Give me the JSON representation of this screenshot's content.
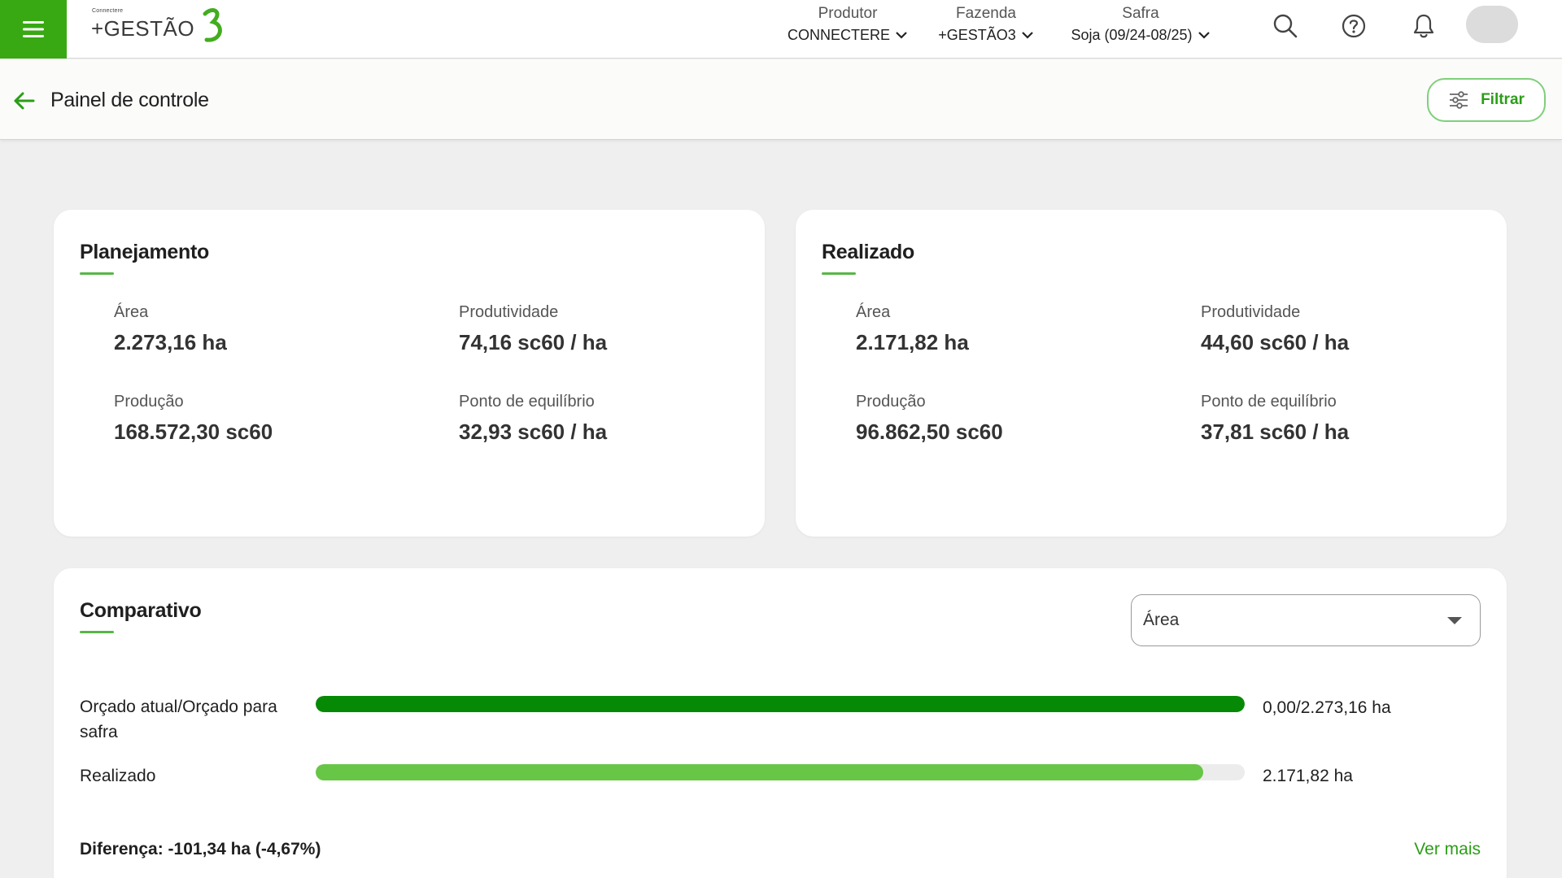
{
  "colors": {
    "brand_green": "#38a813",
    "accent_green": "#2c9d18",
    "bar_planned": "#068a05",
    "bar_realized": "#67c645",
    "background": "#efefef"
  },
  "header": {
    "logo_small": "Connectere",
    "logo_text": "+GESTÃO",
    "selectors": [
      {
        "label": "Produtor",
        "value": "CONNECTERE"
      },
      {
        "label": "Fazenda",
        "value": "+GESTÃO3"
      },
      {
        "label": "Safra",
        "value": "Soja (09/24-08/25)"
      }
    ],
    "icons": [
      "menu-icon",
      "search-icon",
      "help-icon",
      "bell-icon",
      "avatar"
    ]
  },
  "subheader": {
    "title": "Painel de controle",
    "filter_label": "Filtrar"
  },
  "planejamento": {
    "title": "Planejamento",
    "metrics": [
      {
        "label": "Área",
        "value": "2.273,16 ha"
      },
      {
        "label": "Produtividade",
        "value": "74,16 sc60 / ha"
      },
      {
        "label": "Produção",
        "value": "168.572,30 sc60"
      },
      {
        "label": "Ponto de equilíbrio",
        "value": "32,93 sc60 / ha"
      }
    ]
  },
  "realizado": {
    "title": "Realizado",
    "metrics": [
      {
        "label": "Área",
        "value": "2.171,82 ha"
      },
      {
        "label": "Produtividade",
        "value": "44,60 sc60 / ha"
      },
      {
        "label": "Produção",
        "value": "96.862,50 sc60"
      },
      {
        "label": "Ponto de equilíbrio",
        "value": "37,81 sc60 / ha"
      }
    ]
  },
  "comparativo": {
    "title": "Comparativo",
    "select_value": "Área",
    "rows": [
      {
        "label": "Orçado atual/Orçado para safra",
        "value_text": "0,00/2.273,16 ha",
        "fill": 1.0
      },
      {
        "label": "Realizado",
        "value_text": "2.171,82 ha",
        "fill": 0.9554
      }
    ],
    "difference": "Diferença: -101,34 ha (-4,67%)",
    "more_link": "Ver mais"
  }
}
